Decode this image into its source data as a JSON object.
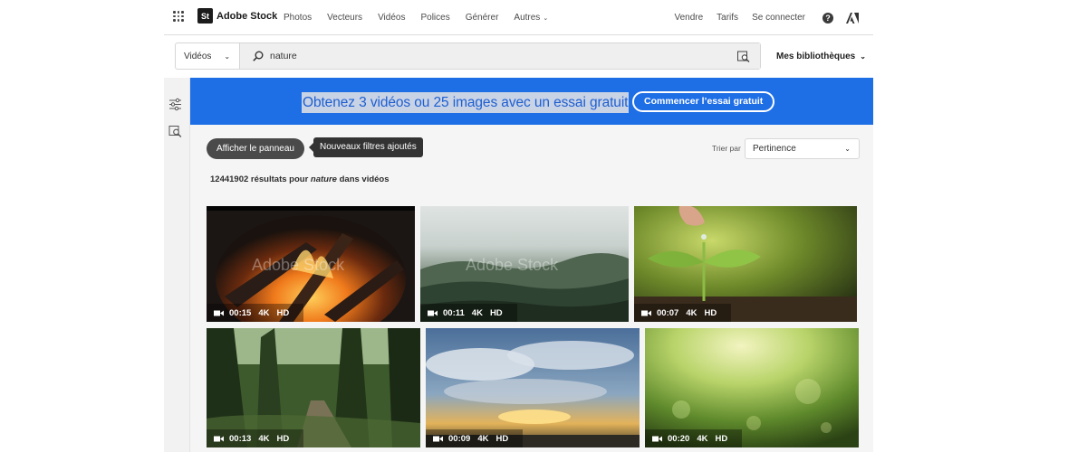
{
  "header": {
    "brand_mark": "St",
    "brand_name": "Adobe Stock",
    "nav": [
      "Photos",
      "Vecteurs",
      "Vidéos",
      "Polices",
      "Générer"
    ],
    "more_label": "Autres",
    "right_links": [
      "Vendre",
      "Tarifs",
      "Se connecter"
    ],
    "help_glyph": "?"
  },
  "search": {
    "type_label": "Vidéos",
    "query": "nature",
    "libraries_label": "Mes bibliothèques"
  },
  "banner": {
    "text": "Obtenez 3 vidéos ou 25 images avec un essai gratuit",
    "button_label": "Commencer l’essai gratuit",
    "color": "#1e6ee6"
  },
  "toolbar": {
    "panel_button": "Afficher le panneau",
    "tooltip": "Nouveaux filtres ajoutés",
    "sort_label": "Trier par",
    "sort_value": "Pertinence"
  },
  "results": {
    "count": "12441902",
    "text_before": "résultats pour",
    "query": "nature",
    "text_after": "dans vidéos"
  },
  "videos": [
    {
      "subject": "campfire",
      "duration": "00:15",
      "res": "4K",
      "quality": "HD",
      "watermark": "Adobe Stock"
    },
    {
      "subject": "misty forest",
      "duration": "00:11",
      "res": "4K",
      "quality": "HD",
      "watermark": "Adobe Stock"
    },
    {
      "subject": "sprout with water drop",
      "duration": "00:07",
      "res": "4K",
      "quality": "HD"
    },
    {
      "subject": "forest path",
      "duration": "00:13",
      "res": "4K",
      "quality": "HD"
    },
    {
      "subject": "cloudy sunset sky",
      "duration": "00:09",
      "res": "4K",
      "quality": "HD"
    },
    {
      "subject": "green bokeh light",
      "duration": "00:20",
      "res": "4K",
      "quality": "HD"
    }
  ]
}
